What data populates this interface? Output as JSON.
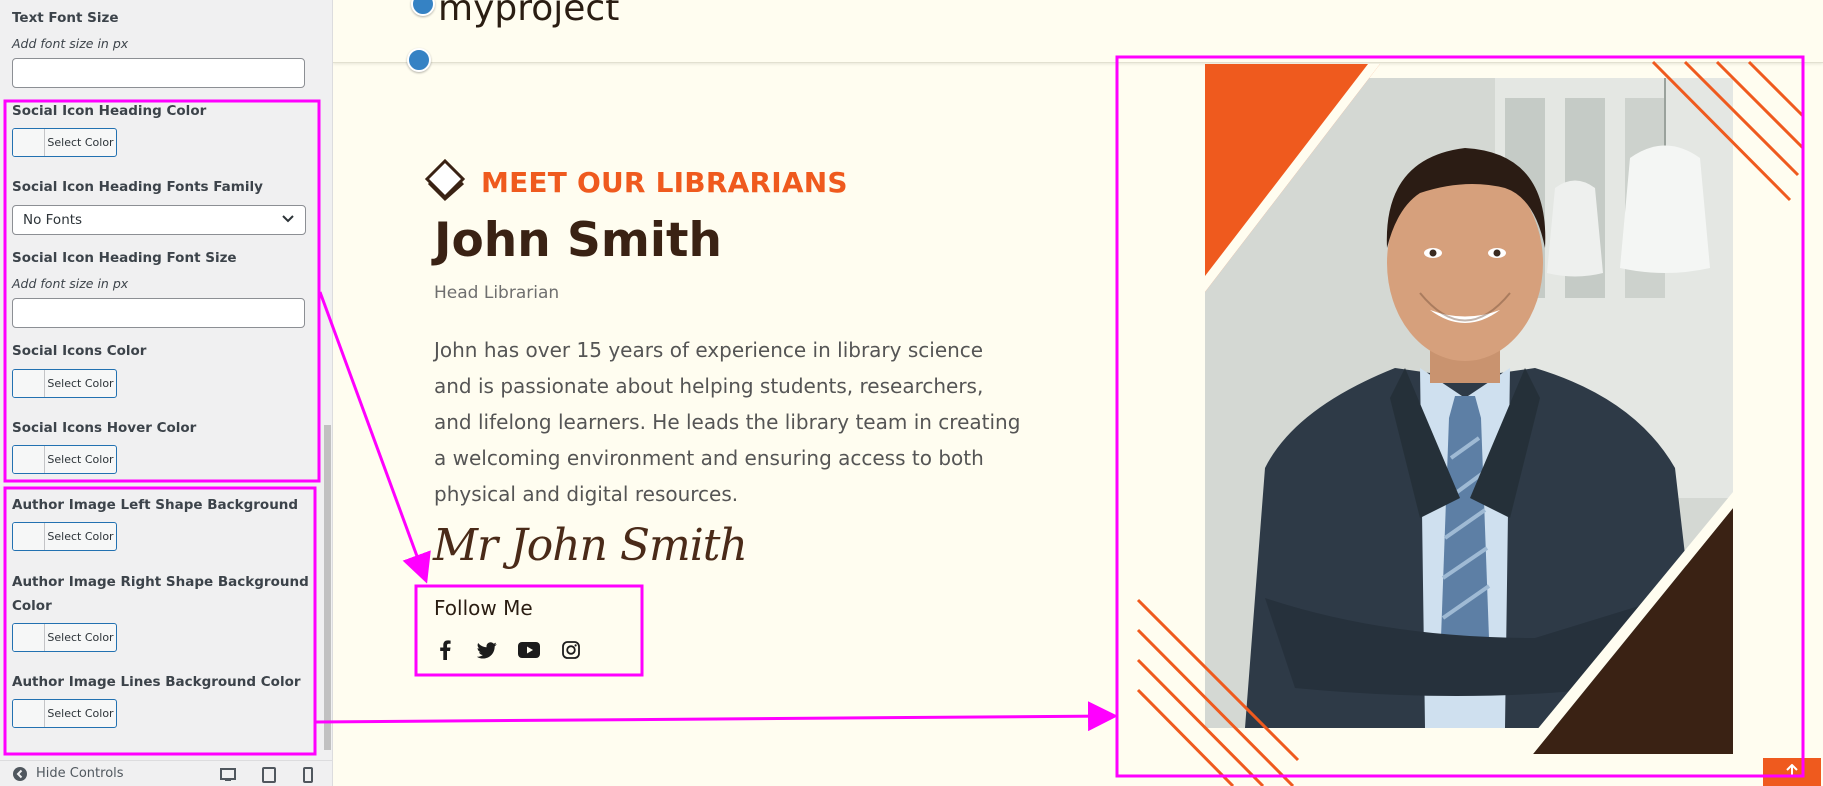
{
  "sidebar": {
    "text_font_size": {
      "label": "Text Font Size",
      "desc": "Add font size in px",
      "value": ""
    },
    "social_heading_color": {
      "label": "Social Icon Heading Color",
      "button": "Select Color"
    },
    "social_heading_font_family": {
      "label": "Social Icon Heading Fonts Family",
      "value": "No Fonts"
    },
    "social_heading_font_size": {
      "label": "Social Icon Heading Font Size",
      "desc": "Add font size in px",
      "value": ""
    },
    "social_icons_color": {
      "label": "Social Icons Color",
      "button": "Select Color"
    },
    "social_icons_hover_color": {
      "label": "Social Icons Hover Color",
      "button": "Select Color"
    },
    "author_left_shape_color": {
      "label": "Author Image Left Shape Background Color",
      "button": "Select Color"
    },
    "author_right_shape_color": {
      "label_line1": "Author Image Right Shape Background",
      "label_line2": "Color",
      "button": "Select Color"
    },
    "author_lines_color": {
      "label": "Author Image Lines Background Color",
      "button": "Select Color"
    },
    "footer": {
      "hide_controls": "Hide Controls"
    }
  },
  "preview": {
    "site_title": "myproject",
    "eyebrow": "MEET OUR LIBRARIANS",
    "name": "John Smith",
    "role": "Head Librarian",
    "bio": "John has over 15 years of experience in library science and is passionate about helping students, researchers, and lifelong learners. He leads the library team in creating a welcoming environment and ensuring access to both physical and digital resources.",
    "signature": "Mr John Smith",
    "follow_title": "Follow Me",
    "social_icons": [
      "facebook-icon",
      "twitter-icon",
      "youtube-icon",
      "instagram-icon"
    ]
  },
  "colors": {
    "accent_orange": "#ef5a1e",
    "dark_brown": "#3a2214",
    "annotation_magenta": "#ff00ff",
    "page_background": "#fffdf0"
  }
}
